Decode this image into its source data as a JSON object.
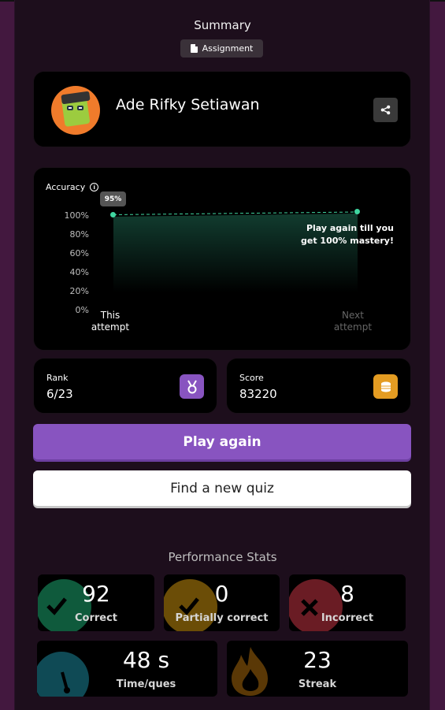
{
  "header": {
    "title": "Summary",
    "badge": "Assignment"
  },
  "user": {
    "name": "Ade Rifky Setiawan"
  },
  "accuracy": {
    "label": "Accuracy",
    "bubble": "95%",
    "ticks": [
      "100%",
      "80%",
      "60%",
      "40%",
      "20%",
      "0%"
    ],
    "x_this": [
      "This",
      "attempt"
    ],
    "x_next": [
      "Next",
      "attempt"
    ],
    "note": [
      "Play again till you",
      "get 100% mastery!"
    ]
  },
  "chart_data": {
    "type": "area",
    "categories": [
      "This attempt",
      "Next attempt"
    ],
    "values": [
      95,
      100
    ],
    "ylabel": "Accuracy",
    "ylim": [
      0,
      100
    ]
  },
  "rank": {
    "label": "Rank",
    "value": "6/23"
  },
  "score": {
    "label": "Score",
    "value": "83220"
  },
  "buttons": {
    "play_again": "Play again",
    "find_quiz": "Find a new quiz"
  },
  "performance": {
    "title": "Performance Stats",
    "correct": {
      "value": "92",
      "label": "Correct"
    },
    "partial": {
      "value": "0",
      "label": "Partially correct"
    },
    "incorrect": {
      "value": "8",
      "label": "Incorrect"
    },
    "time": {
      "value": "48 s",
      "label": "Time/ques"
    },
    "streak": {
      "value": "23",
      "label": "Streak"
    }
  },
  "colors": {
    "accent": "#8854c0",
    "correct": "#0f5a3c",
    "partial": "#6b4d07",
    "incorrect": "#6a1c24",
    "time": "#0f4a55",
    "streak": "#5a3806",
    "rank_icon": "#8854c0",
    "score_icon": "#e49c22"
  }
}
